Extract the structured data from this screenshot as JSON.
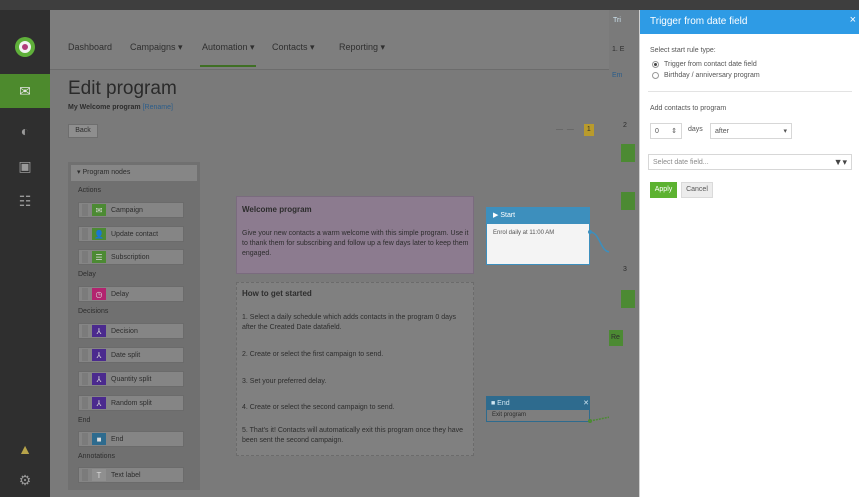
{
  "nav": {
    "items": [
      "Dashboard",
      "Campaigns ▾",
      "Automation ▾",
      "Contacts ▾",
      "Reporting ▾"
    ]
  },
  "page": {
    "title": "Edit program",
    "program_name": "My Welcome program",
    "rename_link": "[Rename]",
    "back_label": "Back",
    "pager_badge": "1"
  },
  "nodes": {
    "header": "▾ Program nodes",
    "groups": {
      "actions": "Actions",
      "delay": "Delay",
      "decisions": "Decisions",
      "end": "End",
      "annotations": "Annotations"
    },
    "items": [
      "Campaign",
      "Update contact",
      "Subscription",
      "Delay",
      "Decision",
      "Date split",
      "Quantity split",
      "Random split",
      "End",
      "Text label"
    ]
  },
  "welcome": {
    "title": "Welcome program",
    "text": "Give your new contacts a warm welcome with this simple program.  Use it to thank them for subscribing and follow up a few days later to keep them engaged."
  },
  "howto": {
    "title": "How to get started",
    "steps": [
      "1. Select a daily schedule which adds contacts in the program 0 days after the Created Date datafield.",
      "2. Create or select the first campaign to send.",
      "3. Set your preferred delay.",
      "4. Create or select the second campaign to send.",
      "5. That's it! Contacts will automatically exit this program once they have been sent the second campaign."
    ]
  },
  "start_node": {
    "title": "▶ Start",
    "text": "Enrol daily at 11:00 AM"
  },
  "end_node": {
    "title": "■ End",
    "text": "Exit program"
  },
  "behind": {
    "tab": "Tri",
    "row1": "1. E",
    "row2": "Em",
    "n2": "2",
    "n3": "3",
    "rk": "Re"
  },
  "drawer": {
    "title": "Trigger from date field",
    "close": "×",
    "rule_type_label": "Select start rule type:",
    "option1": "Trigger from contact date field",
    "option2": "Birthday / anniversary program",
    "add_label": "Add contacts to program",
    "days_value": "0",
    "days_unit": "days",
    "when_value": "after",
    "date_field_placeholder": "Select date field...",
    "apply": "Apply",
    "cancel": "Cancel"
  },
  "colors": {
    "accent": "#2e9be5",
    "apply": "#5cb230",
    "start": "#3d8fbd"
  }
}
